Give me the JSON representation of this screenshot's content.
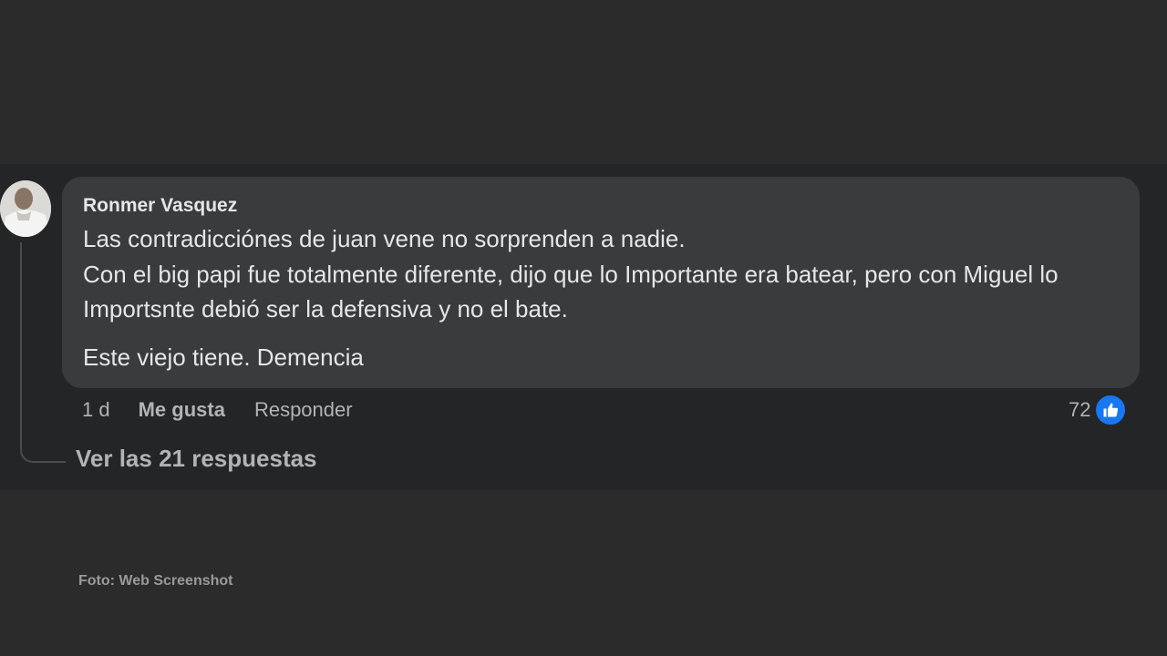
{
  "comment": {
    "author": "Ronmer Vasquez",
    "lines": [
      "Las contradicciónes de juan vene no sorprenden a nadie.",
      "Con el big papi fue totalmente diferente, dijo que lo Importante era batear, pero con Miguel lo Importsnte debió ser la defensiva y no el bate.",
      "Este viejo tiene. Demencia"
    ],
    "time": "1 d",
    "like_label": "Me gusta",
    "reply_label": "Responder",
    "reaction_count": "72",
    "reaction_icon": "like-icon"
  },
  "replies": {
    "label": "Ver las 21 respuestas"
  },
  "credit": "Foto: Web Screenshot",
  "colors": {
    "background": "#2b2b2b",
    "band": "#242526",
    "bubble": "#3a3b3c",
    "text_primary": "#e4e6eb",
    "text_secondary": "#b0b3b8",
    "like_blue": "#1877f2"
  }
}
